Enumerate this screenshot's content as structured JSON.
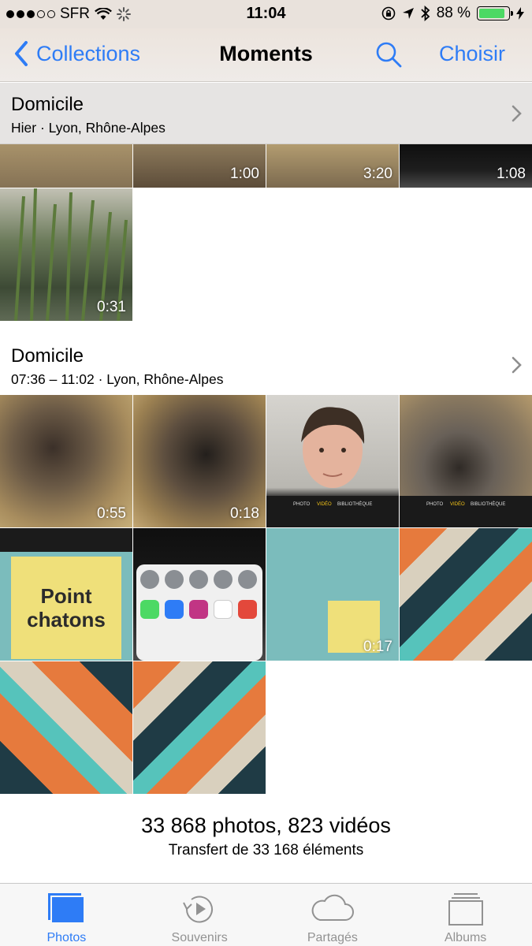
{
  "status": {
    "carrier": "SFR",
    "time": "11:04",
    "battery": "88 %",
    "battery_level": 0.88
  },
  "nav": {
    "back_label": "Collections",
    "title": "Moments",
    "action_label": "Choisir"
  },
  "moments": [
    {
      "title": "Domicile",
      "subtitle": "Hier · Lyon, Rhône-Alpes",
      "durations": [
        "1:00",
        "3:20",
        "1:08",
        "0:31"
      ]
    },
    {
      "title": "Domicile",
      "subtitle": "07:36 – 11:02 · Lyon, Rhône-Alpes",
      "durations": [
        "0:55",
        "0:18",
        "0:17"
      ],
      "note_text": "Point chatons"
    }
  ],
  "counts": {
    "summary": "33 868 photos, 823 vidéos",
    "transfer": "Transfert de 33 168 éléments"
  },
  "tabs": [
    {
      "label": "Photos",
      "icon": "photos-icon",
      "active": true
    },
    {
      "label": "Souvenirs",
      "icon": "memories-icon",
      "active": false
    },
    {
      "label": "Partagés",
      "icon": "cloud-icon",
      "active": false
    },
    {
      "label": "Albums",
      "icon": "albums-icon",
      "active": false
    }
  ],
  "colors": {
    "accent": "#2e7cf6",
    "battery_fill": "#4cd964"
  }
}
